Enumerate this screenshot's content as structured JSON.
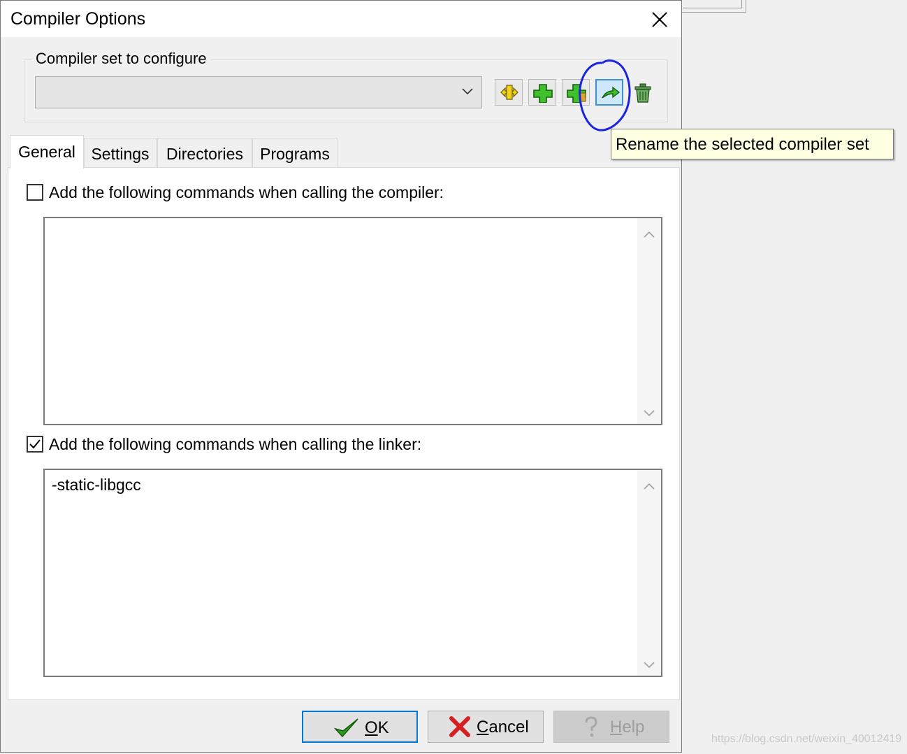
{
  "dialog": {
    "title": "Compiler Options",
    "close_icon": "close-icon"
  },
  "compiler_set": {
    "group_label": "Compiler set to configure",
    "selected_value": "",
    "toolbar_icons": [
      "find-compiler-set-icon",
      "add-blank-compiler-set-icon",
      "add-compiler-set-folder-icon",
      "rename-compiler-set-icon",
      "delete-compiler-set-icon"
    ],
    "tooltip": "Rename the selected compiler set"
  },
  "tabs": [
    {
      "label": "General",
      "active": true
    },
    {
      "label": "Settings",
      "active": false
    },
    {
      "label": "Directories",
      "active": false
    },
    {
      "label": "Programs",
      "active": false
    }
  ],
  "general": {
    "compiler_cmd": {
      "label": "Add the following commands when calling the compiler:",
      "checked": false,
      "value": ""
    },
    "linker_cmd": {
      "label": "Add the following commands when calling the linker:",
      "checked": true,
      "value": "-static-libgcc"
    }
  },
  "buttons": {
    "ok": {
      "accel": "O",
      "rest": "K"
    },
    "cancel": {
      "accel": "C",
      "rest": "ancel"
    },
    "help": {
      "accel": "H",
      "rest": "elp",
      "enabled": false
    }
  },
  "colors": {
    "annotation": "#1b24e0",
    "tooltip_bg": "#ffffe1",
    "default_button_border": "#0078d7"
  },
  "watermark": "https://blog.csdn.net/weixin_40012419"
}
